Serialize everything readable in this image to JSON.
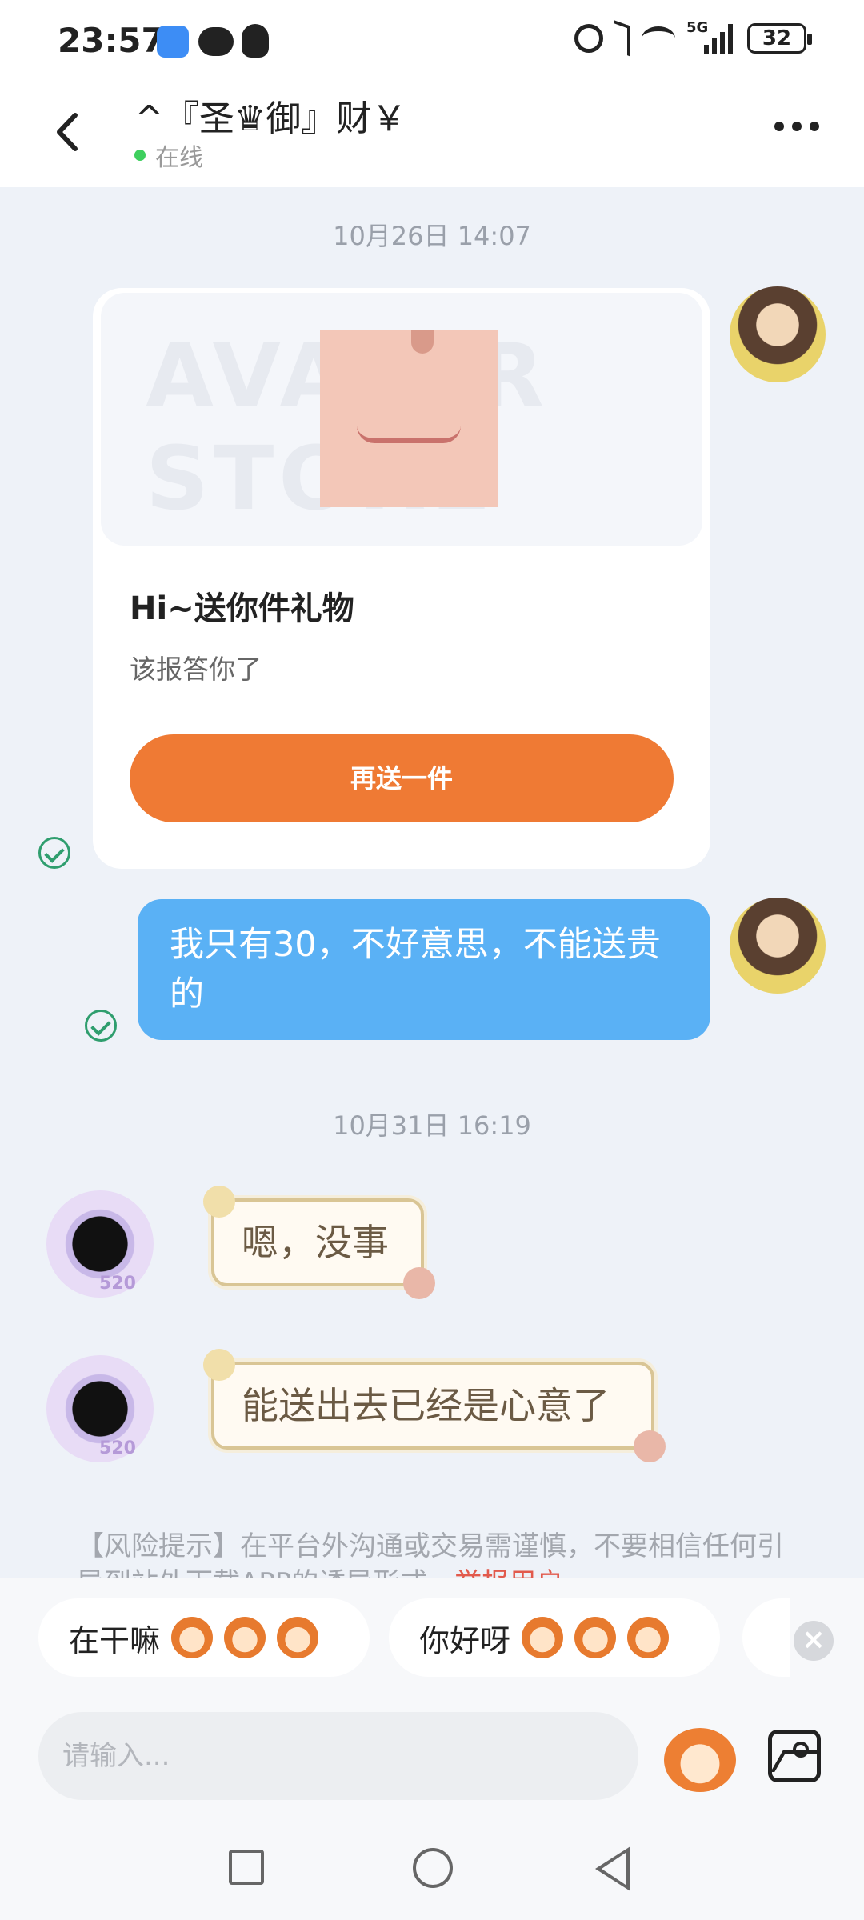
{
  "status_bar": {
    "time": "23:57",
    "battery": "32",
    "network": "5G",
    "app_icons": [
      "honor-app-icon",
      "wechat-icon",
      "qq-icon"
    ],
    "system_icons": [
      "alarm-icon",
      "bluetooth-icon",
      "wifi-icon",
      "signal-icon"
    ]
  },
  "header": {
    "title": "^『圣♛御』财￥",
    "status": "在线"
  },
  "chat": {
    "timestamp1": "10月26日 14:07",
    "gift_card": {
      "watermark": "AVATAR STORE",
      "title": "Hi~送你件礼物",
      "subtitle": "该报答你了",
      "button": "再送一件"
    },
    "my_message": "我只有30，不好意思，不能送贵的",
    "timestamp2": "10月31日 16:19",
    "received": [
      {
        "text": "嗯，没事",
        "badge": "520"
      },
      {
        "text": "能送出去已经是心意了",
        "badge": "520"
      }
    ]
  },
  "risk_notice": {
    "text": "【风险提示】在平台外沟通或交易需谨慎，不要相信任何引导到站外下载APP的诱导形式，",
    "link": "举报用户"
  },
  "quick_replies": [
    {
      "label": "在干嘛",
      "emoji_count": 3
    },
    {
      "label": "你好呀",
      "emoji_count": 3
    }
  ],
  "input": {
    "placeholder": "请输入..."
  },
  "colors": {
    "accent_orange": "#ef7a34",
    "my_bubble": "#5ab1f5",
    "online_dot": "#3ecf5e",
    "read_check": "#2f9e6e",
    "report_link": "#e25a4c"
  }
}
